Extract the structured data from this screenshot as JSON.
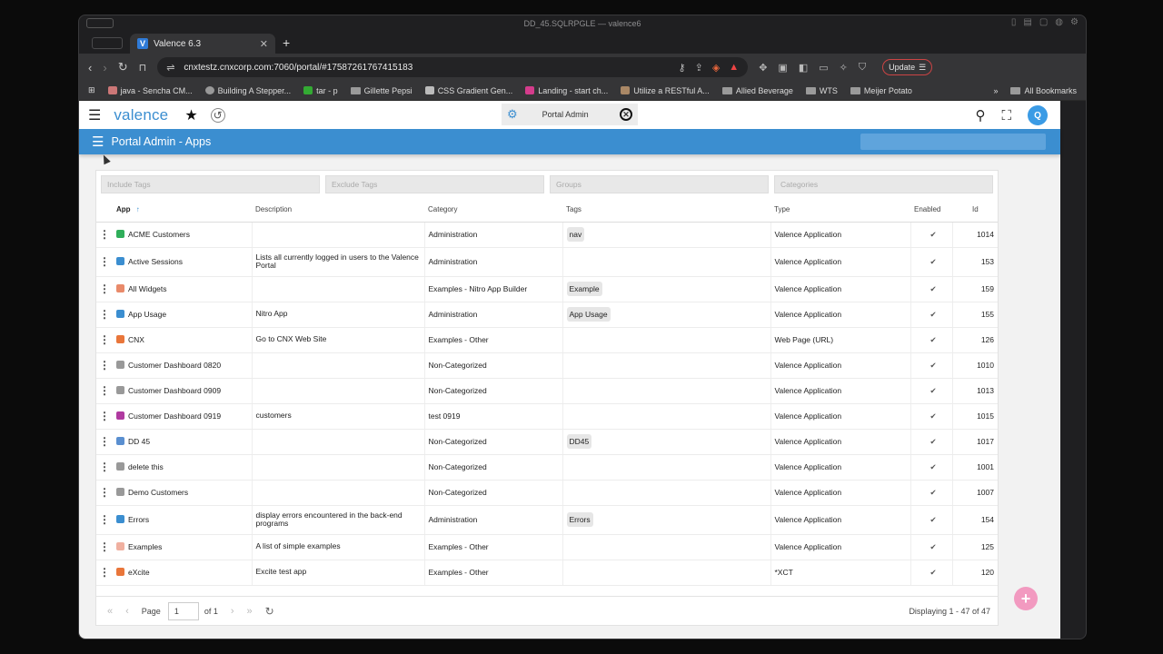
{
  "window_title": "DD_45.SQLRPGLE — valence6",
  "tab": {
    "title": "Valence 6.3",
    "favicon": "V"
  },
  "omnibox": {
    "url": "cnxtestz.cnxcorp.com:7060/portal/#17587261767415183"
  },
  "toolbar": {
    "update_label": "Update"
  },
  "bookmarks": [
    "java - Sencha CM...",
    "Building A Stepper...",
    "tar - p",
    "Gillette Pepsi",
    "CSS Gradient Gen...",
    "Landing - start ch...",
    "Utilize a RESTful A...",
    "Allied Beverage",
    "WTS",
    "Meijer Potato"
  ],
  "bookmarks_all": "All Bookmarks",
  "app_header": {
    "logo": "valence",
    "center_tab": "Portal Admin",
    "avatar": "Q"
  },
  "title_bar": {
    "title": "Portal Admin - Apps"
  },
  "filters": [
    "Include Tags",
    "Exclude Tags",
    "Groups",
    "Categories"
  ],
  "columns": {
    "app": "App",
    "sort": "↑",
    "description": "Description",
    "category": "Category",
    "tags": "Tags",
    "type": "Type",
    "enabled": "Enabled",
    "id": "Id"
  },
  "rows": [
    {
      "app": "ACME Customers",
      "icon": "#2fae5a",
      "description": "",
      "category": "Administration",
      "tag": "nav",
      "type": "Valence Application",
      "enabled": "✔",
      "id": "1014"
    },
    {
      "app": "Active Sessions",
      "icon": "#3b8ed0",
      "description": "Lists all currently logged in users to the Valence Portal",
      "category": "Administration",
      "tag": "",
      "type": "Valence Application",
      "enabled": "✔",
      "id": "153"
    },
    {
      "app": "All Widgets",
      "icon": "#e98a6a",
      "description": "",
      "category": "Examples - Nitro App Builder",
      "tag": "Example",
      "type": "Valence Application",
      "enabled": "✔",
      "id": "159"
    },
    {
      "app": "App Usage",
      "icon": "#3b8ed0",
      "description": "Nitro App",
      "category": "Administration",
      "tag": "App Usage",
      "type": "Valence Application",
      "enabled": "✔",
      "id": "155"
    },
    {
      "app": "CNX",
      "icon": "#e9763a",
      "description": "Go to CNX Web Site",
      "category": "Examples - Other",
      "tag": "",
      "type": "Web Page (URL)",
      "enabled": "✔",
      "id": "126"
    },
    {
      "app": "Customer Dashboard 0820",
      "icon": "#999999",
      "description": "",
      "category": "Non-Categorized",
      "tag": "",
      "type": "Valence Application",
      "enabled": "✔",
      "id": "1010"
    },
    {
      "app": "Customer Dashboard 0909",
      "icon": "#999999",
      "description": "",
      "category": "Non-Categorized",
      "tag": "",
      "type": "Valence Application",
      "enabled": "✔",
      "id": "1013"
    },
    {
      "app": "Customer Dashboard 0919",
      "icon": "#b03aa0",
      "description": "customers",
      "category": "test 0919",
      "tag": "",
      "type": "Valence Application",
      "enabled": "✔",
      "id": "1015"
    },
    {
      "app": "DD 45",
      "icon": "#5a8fd0",
      "description": "",
      "category": "Non-Categorized",
      "tag": "DD45",
      "type": "Valence Application",
      "enabled": "✔",
      "id": "1017"
    },
    {
      "app": "delete this",
      "icon": "#999999",
      "description": "",
      "category": "Non-Categorized",
      "tag": "",
      "type": "Valence Application",
      "enabled": "✔",
      "id": "1001"
    },
    {
      "app": "Demo Customers",
      "icon": "#999999",
      "description": "",
      "category": "Non-Categorized",
      "tag": "",
      "type": "Valence Application",
      "enabled": "✔",
      "id": "1007"
    },
    {
      "app": "Errors",
      "icon": "#3b8ed0",
      "description": "display errors encountered in the back-end programs",
      "category": "Administration",
      "tag": "Errors",
      "type": "Valence Application",
      "enabled": "✔",
      "id": "154"
    },
    {
      "app": "Examples",
      "icon": "#f0b0a0",
      "description": "A list of simple examples",
      "category": "Examples - Other",
      "tag": "",
      "type": "Valence Application",
      "enabled": "✔",
      "id": "125"
    },
    {
      "app": "eXcite",
      "icon": "#e9763a",
      "description": "Excite test app",
      "category": "Examples - Other",
      "tag": "",
      "type": "*XCT",
      "enabled": "✔",
      "id": "120"
    }
  ],
  "pager": {
    "page_label": "Page",
    "page_value": "1",
    "of_label": "of 1",
    "display": "Displaying 1 - 47 of 47"
  },
  "fab": "+"
}
